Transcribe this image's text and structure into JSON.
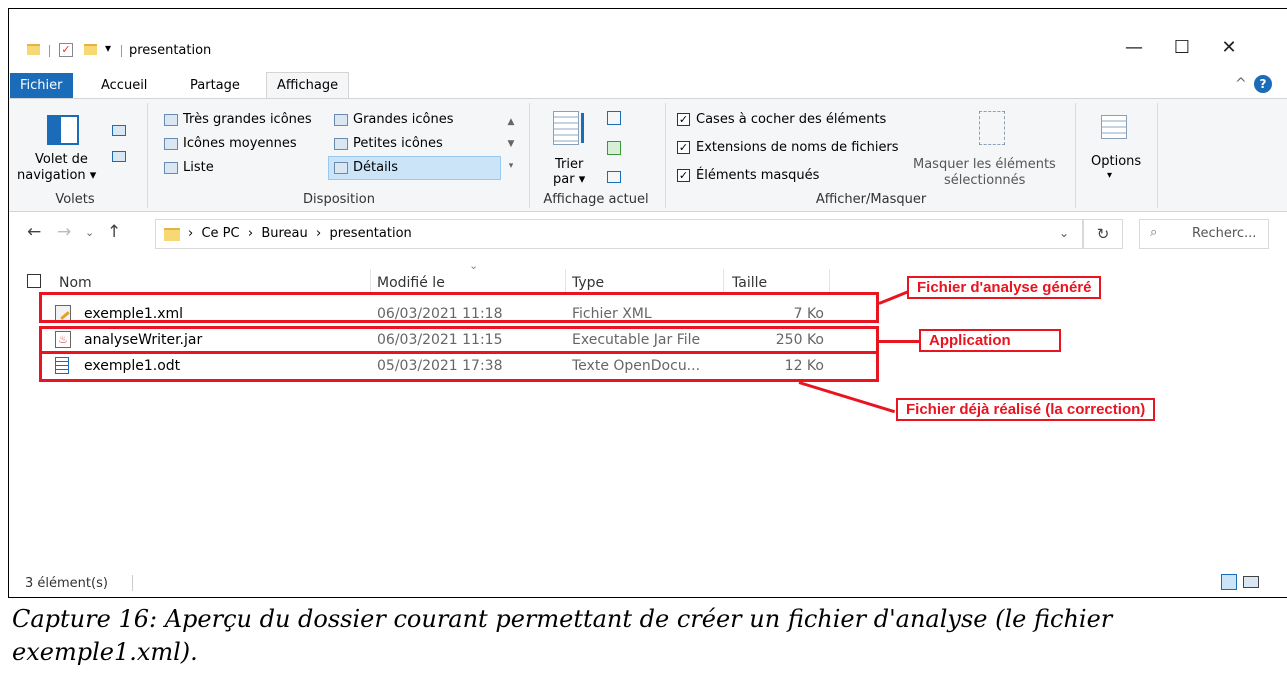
{
  "window": {
    "title": "presentation",
    "qa_dropdown": "▾"
  },
  "ribbon": {
    "tabs": [
      "Fichier",
      "Accueil",
      "Partage",
      "Affichage"
    ],
    "volets": {
      "nav_label_1": "Volet de",
      "nav_label_2": "navigation",
      "group": "Volets"
    },
    "disposition": {
      "items": [
        "Très grandes icônes",
        "Grandes icônes",
        "Icônes moyennes",
        "Petites icônes",
        "Liste",
        "Détails"
      ],
      "selected": "Détails",
      "group": "Disposition"
    },
    "affichage_actuel": {
      "sort_1": "Trier",
      "sort_2": "par",
      "group": "Affichage actuel"
    },
    "afficher_masquer": {
      "checkboxes": [
        {
          "label": "Cases à cocher des éléments",
          "checked": true
        },
        {
          "label": "Extensions de noms de fichiers",
          "checked": true
        },
        {
          "label": "Éléments masqués",
          "checked": true
        }
      ],
      "hide_1": "Masquer les éléments",
      "hide_2": "sélectionnés",
      "group": "Afficher/Masquer"
    },
    "options": "Options"
  },
  "address": {
    "path": [
      "Ce PC",
      "Bureau",
      "presentation"
    ],
    "search_placeholder": "Recherc..."
  },
  "columns": [
    "Nom",
    "Modifié le",
    "Type",
    "Taille"
  ],
  "files": [
    {
      "name": "exemple1.xml",
      "date": "06/03/2021 11:18",
      "type": "Fichier XML",
      "size": "7 Ko",
      "icon": "xml-file-icon"
    },
    {
      "name": "analyseWriter.jar",
      "date": "06/03/2021 11:15",
      "type": "Executable Jar File",
      "size": "250 Ko",
      "icon": "jar-file-icon"
    },
    {
      "name": "exemple1.odt",
      "date": "05/03/2021 17:38",
      "type": "Texte OpenDocu...",
      "size": "12 Ko",
      "icon": "odt-file-icon"
    }
  ],
  "status": "3 élément(s)",
  "callouts": [
    "Fichier d'analyse généré",
    "Application",
    "Fichier déjà réalisé (la correction)"
  ],
  "caption": "Capture 16: Aperçu du dossier courant permettant de créer un fichier d'analyse (le fichier exemple1.xml).",
  "colors": {
    "accent": "#1a6bb8",
    "annotation": "#e8141f"
  }
}
